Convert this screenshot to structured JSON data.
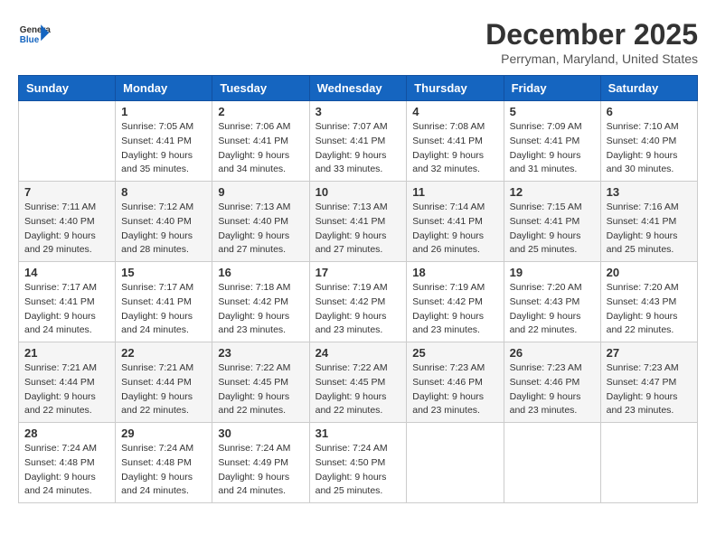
{
  "header": {
    "logo": {
      "general": "General",
      "blue": "Blue"
    },
    "title": "December 2025",
    "location": "Perryman, Maryland, United States"
  },
  "days_of_week": [
    "Sunday",
    "Monday",
    "Tuesday",
    "Wednesday",
    "Thursday",
    "Friday",
    "Saturday"
  ],
  "weeks": [
    [
      {
        "day": "",
        "info": ""
      },
      {
        "day": "1",
        "info": "Sunrise: 7:05 AM\nSunset: 4:41 PM\nDaylight: 9 hours\nand 35 minutes."
      },
      {
        "day": "2",
        "info": "Sunrise: 7:06 AM\nSunset: 4:41 PM\nDaylight: 9 hours\nand 34 minutes."
      },
      {
        "day": "3",
        "info": "Sunrise: 7:07 AM\nSunset: 4:41 PM\nDaylight: 9 hours\nand 33 minutes."
      },
      {
        "day": "4",
        "info": "Sunrise: 7:08 AM\nSunset: 4:41 PM\nDaylight: 9 hours\nand 32 minutes."
      },
      {
        "day": "5",
        "info": "Sunrise: 7:09 AM\nSunset: 4:41 PM\nDaylight: 9 hours\nand 31 minutes."
      },
      {
        "day": "6",
        "info": "Sunrise: 7:10 AM\nSunset: 4:40 PM\nDaylight: 9 hours\nand 30 minutes."
      }
    ],
    [
      {
        "day": "7",
        "info": "Sunrise: 7:11 AM\nSunset: 4:40 PM\nDaylight: 9 hours\nand 29 minutes."
      },
      {
        "day": "8",
        "info": "Sunrise: 7:12 AM\nSunset: 4:40 PM\nDaylight: 9 hours\nand 28 minutes."
      },
      {
        "day": "9",
        "info": "Sunrise: 7:13 AM\nSunset: 4:40 PM\nDaylight: 9 hours\nand 27 minutes."
      },
      {
        "day": "10",
        "info": "Sunrise: 7:13 AM\nSunset: 4:41 PM\nDaylight: 9 hours\nand 27 minutes."
      },
      {
        "day": "11",
        "info": "Sunrise: 7:14 AM\nSunset: 4:41 PM\nDaylight: 9 hours\nand 26 minutes."
      },
      {
        "day": "12",
        "info": "Sunrise: 7:15 AM\nSunset: 4:41 PM\nDaylight: 9 hours\nand 25 minutes."
      },
      {
        "day": "13",
        "info": "Sunrise: 7:16 AM\nSunset: 4:41 PM\nDaylight: 9 hours\nand 25 minutes."
      }
    ],
    [
      {
        "day": "14",
        "info": "Sunrise: 7:17 AM\nSunset: 4:41 PM\nDaylight: 9 hours\nand 24 minutes."
      },
      {
        "day": "15",
        "info": "Sunrise: 7:17 AM\nSunset: 4:41 PM\nDaylight: 9 hours\nand 24 minutes."
      },
      {
        "day": "16",
        "info": "Sunrise: 7:18 AM\nSunset: 4:42 PM\nDaylight: 9 hours\nand 23 minutes."
      },
      {
        "day": "17",
        "info": "Sunrise: 7:19 AM\nSunset: 4:42 PM\nDaylight: 9 hours\nand 23 minutes."
      },
      {
        "day": "18",
        "info": "Sunrise: 7:19 AM\nSunset: 4:42 PM\nDaylight: 9 hours\nand 23 minutes."
      },
      {
        "day": "19",
        "info": "Sunrise: 7:20 AM\nSunset: 4:43 PM\nDaylight: 9 hours\nand 22 minutes."
      },
      {
        "day": "20",
        "info": "Sunrise: 7:20 AM\nSunset: 4:43 PM\nDaylight: 9 hours\nand 22 minutes."
      }
    ],
    [
      {
        "day": "21",
        "info": "Sunrise: 7:21 AM\nSunset: 4:44 PM\nDaylight: 9 hours\nand 22 minutes."
      },
      {
        "day": "22",
        "info": "Sunrise: 7:21 AM\nSunset: 4:44 PM\nDaylight: 9 hours\nand 22 minutes."
      },
      {
        "day": "23",
        "info": "Sunrise: 7:22 AM\nSunset: 4:45 PM\nDaylight: 9 hours\nand 22 minutes."
      },
      {
        "day": "24",
        "info": "Sunrise: 7:22 AM\nSunset: 4:45 PM\nDaylight: 9 hours\nand 22 minutes."
      },
      {
        "day": "25",
        "info": "Sunrise: 7:23 AM\nSunset: 4:46 PM\nDaylight: 9 hours\nand 23 minutes."
      },
      {
        "day": "26",
        "info": "Sunrise: 7:23 AM\nSunset: 4:46 PM\nDaylight: 9 hours\nand 23 minutes."
      },
      {
        "day": "27",
        "info": "Sunrise: 7:23 AM\nSunset: 4:47 PM\nDaylight: 9 hours\nand 23 minutes."
      }
    ],
    [
      {
        "day": "28",
        "info": "Sunrise: 7:24 AM\nSunset: 4:48 PM\nDaylight: 9 hours\nand 24 minutes."
      },
      {
        "day": "29",
        "info": "Sunrise: 7:24 AM\nSunset: 4:48 PM\nDaylight: 9 hours\nand 24 minutes."
      },
      {
        "day": "30",
        "info": "Sunrise: 7:24 AM\nSunset: 4:49 PM\nDaylight: 9 hours\nand 24 minutes."
      },
      {
        "day": "31",
        "info": "Sunrise: 7:24 AM\nSunset: 4:50 PM\nDaylight: 9 hours\nand 25 minutes."
      },
      {
        "day": "",
        "info": ""
      },
      {
        "day": "",
        "info": ""
      },
      {
        "day": "",
        "info": ""
      }
    ]
  ]
}
